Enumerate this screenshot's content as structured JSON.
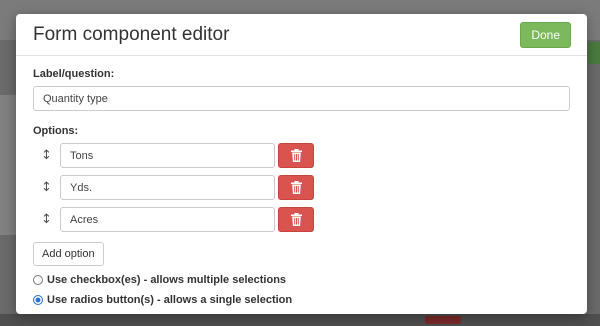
{
  "modal": {
    "title": "Form component editor",
    "done_label": "Done",
    "label_question_label": "Label/question:",
    "label_question_value": "Quantity type",
    "options_label": "Options:",
    "options": [
      {
        "value": "Tons"
      },
      {
        "value": "Yds."
      },
      {
        "value": "Acres"
      }
    ],
    "add_option_label": "Add option",
    "radio_checkbox_label": "Use checkbox(es) - allows multiple selections",
    "radio_radios_label": "Use radios button(s) - allows a single selection",
    "selected_mode": "radios"
  },
  "icons": {
    "drag": "drag-handle-icon",
    "delete": "trash-icon"
  },
  "colors": {
    "done_green": "#7cb95c",
    "delete_red": "#d9534f",
    "radio_blue": "#2f6fd6"
  }
}
